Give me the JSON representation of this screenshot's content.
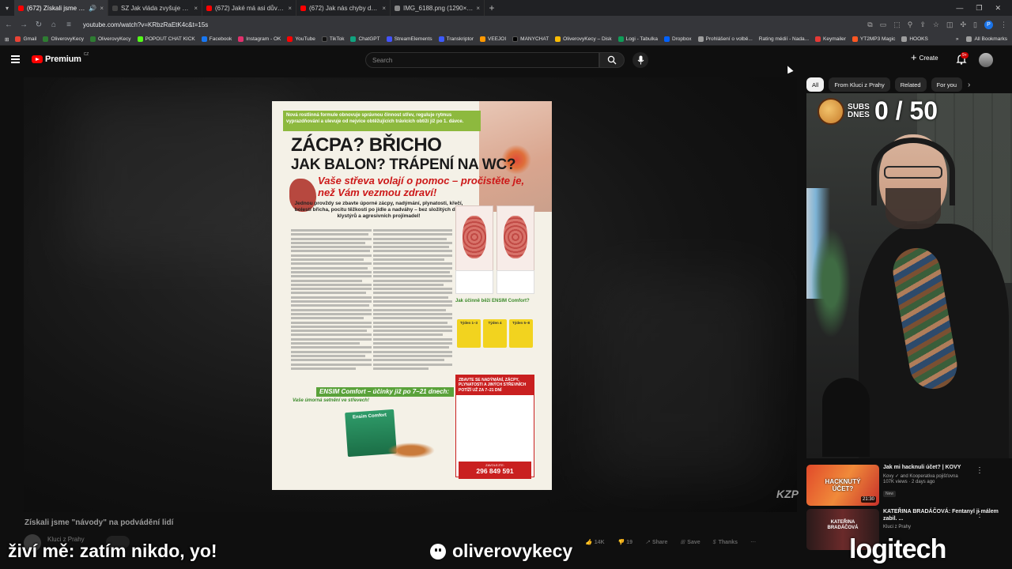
{
  "browser": {
    "tabs": [
      {
        "title": "(672) Získali jsme \"návody\"",
        "color": "#ff0000",
        "active": true
      },
      {
        "title": "SZ  Jak vláda zvyšuje platy: Přidá lé",
        "color": "#444444",
        "active": false
      },
      {
        "title": "(672) Jaké má asi důvody, proč",
        "color": "#ff0000",
        "active": false
      },
      {
        "title": "(672) Jak nás chyby dělají chytř",
        "color": "#ff0000",
        "active": false
      },
      {
        "title": "IMG_6188.png (1290×1405)",
        "color": "#888888",
        "active": false
      }
    ],
    "url": "youtube.com/watch?v=KRbzRaEtK4c&t=15s",
    "bookmarks": [
      {
        "label": "Gmail",
        "color": "#ea4335"
      },
      {
        "label": "OliverovyKecy",
        "color": "#2e7d32"
      },
      {
        "label": "OliverovyKecy",
        "color": "#2e7d32"
      },
      {
        "label": "POPOUT CHAT KICK",
        "color": "#53fc18"
      },
      {
        "label": "Facebook",
        "color": "#1877f2"
      },
      {
        "label": "Instagram - OK",
        "color": "#e1306c"
      },
      {
        "label": "YouTube",
        "color": "#ff0000"
      },
      {
        "label": "TikTok",
        "color": "#111111"
      },
      {
        "label": "ChatGPT",
        "color": "#10a37f"
      },
      {
        "label": "StreamElements",
        "color": "#4353ff"
      },
      {
        "label": "Transkriptor",
        "color": "#3d5afe"
      },
      {
        "label": "VEEJOI",
        "color": "#ff9800"
      },
      {
        "label": "MANYCHAT",
        "color": "#000000"
      },
      {
        "label": "OliverovyKecy – Disk",
        "color": "#fbbc04"
      },
      {
        "label": "Logi - Tabulka",
        "color": "#0f9d58"
      },
      {
        "label": "Dropbox",
        "color": "#0061ff"
      },
      {
        "label": "Prohlášení o volbě...",
        "color": "#9e9e9e"
      },
      {
        "label": "Rating médií - Nada...",
        "color": "#9e9e9e"
      },
      {
        "label": "Keymailer",
        "color": "#e53935"
      },
      {
        "label": "YT2MP3 Magic",
        "color": "#ff5722"
      },
      {
        "label": "HOOKS",
        "color": "#9e9e9e"
      }
    ],
    "all_bookmarks": "All Bookmarks",
    "profile_initial": "P"
  },
  "youtube": {
    "logo_text": "Premium",
    "country_code": "CZ",
    "search_placeholder": "Search",
    "create_label": "Create",
    "notif_count": "9+",
    "chips": [
      "All",
      "From Kluci z Prahy",
      "Related",
      "For you"
    ],
    "video_title": "Získali jsme \"návody\" na podvádění lidí",
    "channel_name": "Kluci z Prahy",
    "actions": {
      "likes": "14K",
      "dislikes": "19",
      "share": "Share",
      "save": "Save",
      "thanks": "Thanks"
    },
    "watermark": "KZP"
  },
  "magazine": {
    "top_band": "Nová rostlinná formule obnovuje správnou činnost střev, reguluje rytmus vyprazdňování a ulevuje od nejvíce obtěžujících trávicích obtíží již po 1. dávce.",
    "headline_1": "ZÁCPA? BŘICHO",
    "headline_2": "JAK BALON? TRÁPENÍ NA WC?",
    "subhead": "Vaše střeva volají o pomoc – pročistěte je, než Vám vezmou zdraví!",
    "intro": "Jednou provždy se zbavte úporné zácpy, nadýmání, plynatosti, křečí, bolestí břicha, pocitu těžkosti po jídle a nadváhy – bez složitých diet, klystýrů a agresivních projímadel!",
    "question": "Jak účinně běží ENSIM Comfort?",
    "steps": [
      "Týden 1–3",
      "Týden 4",
      "Týden 5–8"
    ],
    "product_banner": "ENSIM Comfort – účinky již po 7–21 dnech:",
    "green_heading": "Vaše úmorná setnění ve střevech!",
    "product_name": "Ensim Comfort",
    "red_box_header": "ZBAVTE SE NADÝMÁNÍ, ZÁCPY, PLYNATOSTI A JINÝCH STŘEVNÍCH POTÍŽÍ UŽ ZA 7–21 DNÍ",
    "phone_label": "ZAVOLEJTE:",
    "phone_number": "296 849 591"
  },
  "overlays": {
    "lower_left": "živí mě: zatím nikdo, yo!",
    "handle": "oliverovykecy",
    "sponsor": "logitech",
    "subs_label_1": "SUBS",
    "subs_label_2": "DNES",
    "subs_count": "0 / 50"
  },
  "recommendations": [
    {
      "title": "Jak mi hacknuli účet? | KOVY",
      "channel": "Kovy ✓ and Kooperativa pojišťovna",
      "views": "107K views · 2 days ago",
      "badge": "New",
      "duration": "21:30",
      "thumb_text": "HACKNUTÝ ÚČET?"
    },
    {
      "title": "KATEŘINA BRADÁČOVÁ: Fentanyl ji málem zabil. ...",
      "channel": "Kluci z Prahy",
      "views": "",
      "badge": "",
      "duration": "",
      "thumb_text": "KATEŘINA BRADÁČOVÁ"
    }
  ]
}
